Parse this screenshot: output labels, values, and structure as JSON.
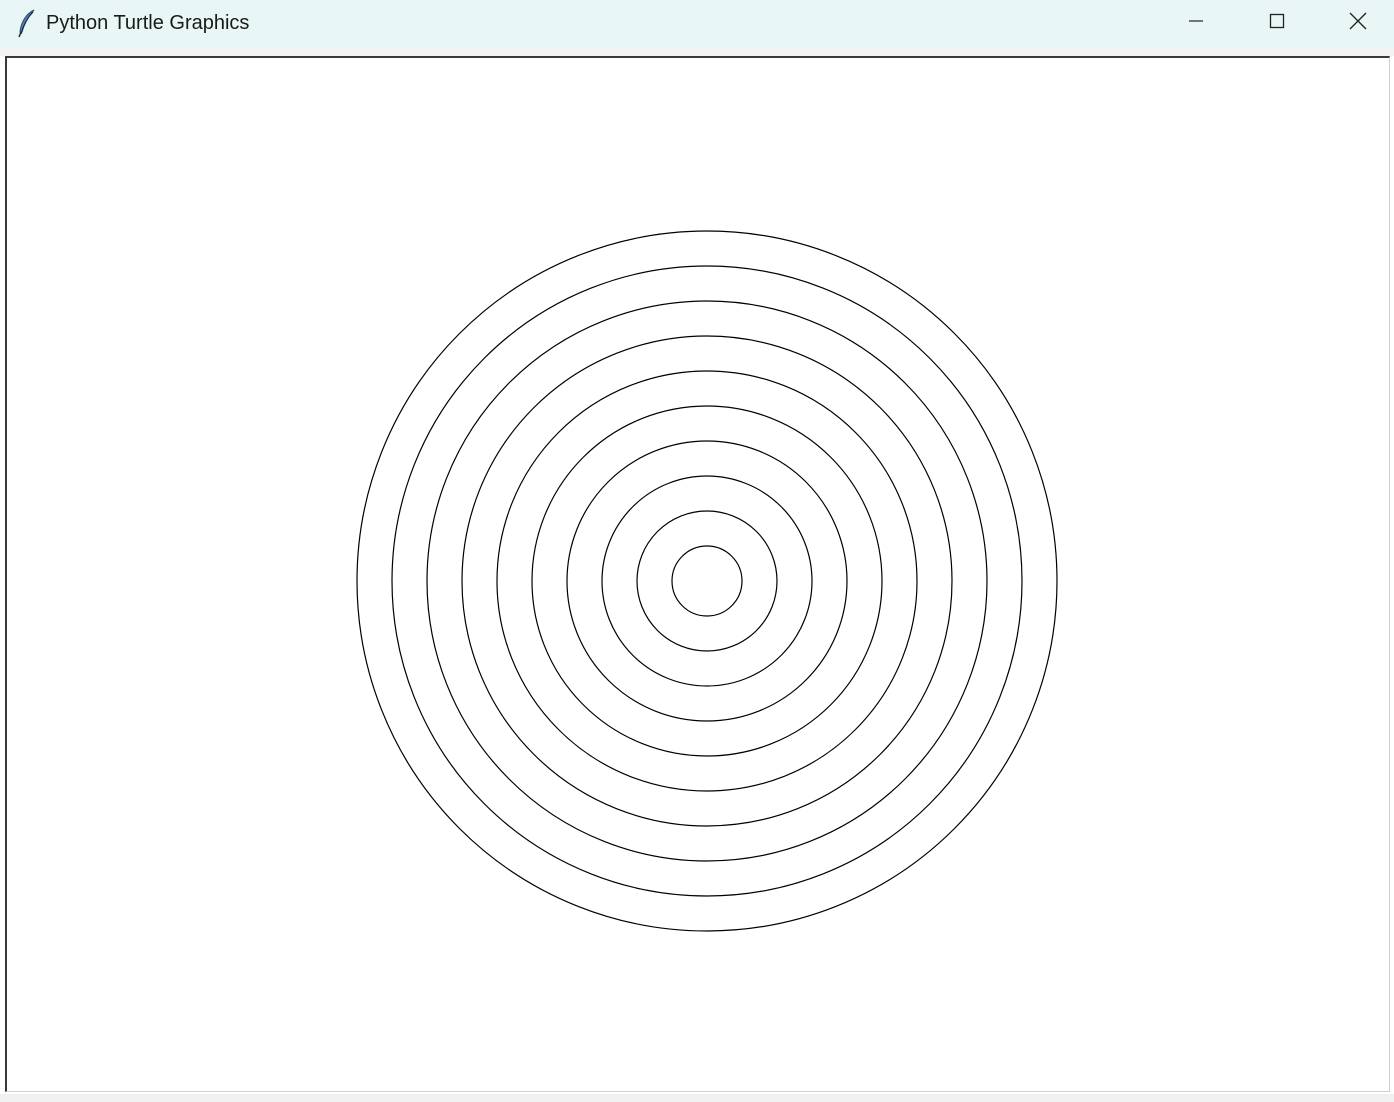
{
  "window": {
    "title": "Python Turtle Graphics",
    "app_icon": "tk-feather-icon",
    "controls": {
      "minimize": "minimize-icon",
      "maximize": "maximize-icon",
      "close": "close-icon"
    }
  },
  "canvas": {
    "background": "#ffffff",
    "pen_color": "#000000",
    "drawing": "concentric-circles",
    "circle_count": 10
  }
}
